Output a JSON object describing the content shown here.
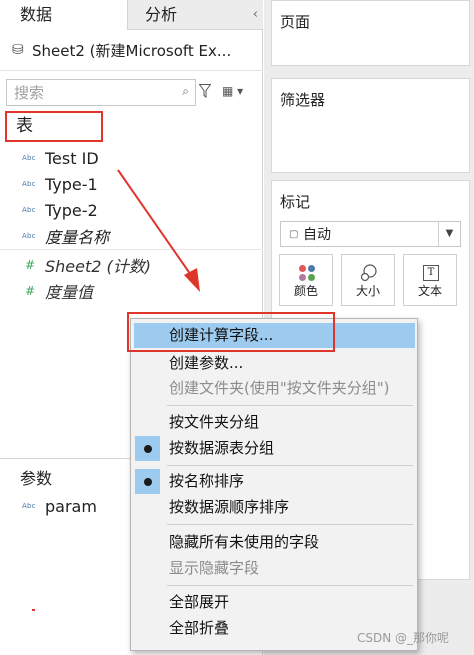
{
  "tabs": {
    "data": "数据",
    "analysis": "分析"
  },
  "data_source": {
    "label": "Sheet2 (新建Microsoft Ex..."
  },
  "search": {
    "placeholder": "搜索"
  },
  "table_section": {
    "label": "表"
  },
  "fields": [
    {
      "type_badge": "Abc",
      "label": "Test ID"
    },
    {
      "type_badge": "Abc",
      "label": "Type-1"
    },
    {
      "type_badge": "Abc",
      "label": "Type-2"
    },
    {
      "type_badge": "Abc",
      "label": "度量名称"
    }
  ],
  "measures": [
    {
      "badge": "#",
      "label": "Sheet2 (计数)"
    },
    {
      "badge": "#",
      "label": "度量值"
    }
  ],
  "parameters": {
    "title": "参数",
    "items": [
      {
        "type_badge": "Abc",
        "label": "param"
      }
    ]
  },
  "shelves": {
    "pages": "页面",
    "filters": "筛选器",
    "marks": "标记"
  },
  "marks": {
    "type_value": "自动",
    "buttons": {
      "color": "颜色",
      "size": "大小",
      "text": "文本"
    }
  },
  "context_menu": {
    "create_calculated_field": "创建计算字段...",
    "create_parameter": "创建参数...",
    "create_folder": "创建文件夹(使用\"按文件夹分组\")",
    "group_by_folder": "按文件夹分组",
    "group_by_data_source_table": "按数据源表分组",
    "sort_by_name": "按名称排序",
    "sort_by_data_source_order": "按数据源顺序排序",
    "hide_all_unused_fields": "隐藏所有未使用的字段",
    "show_hidden_fields": "显示隐藏字段",
    "expand_all": "全部展开",
    "collapse_all": "全部折叠"
  },
  "watermark": "CSDN @_那你呢",
  "colors": {
    "annotation_red": "#e0352b",
    "menu_highlight": "#9ccbef",
    "menu_bg": "#f2f2f2"
  }
}
